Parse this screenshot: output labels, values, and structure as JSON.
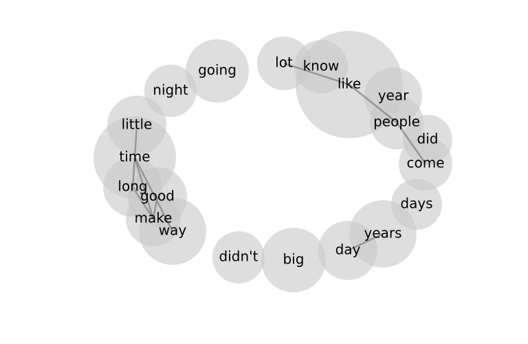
{
  "diagram": {
    "type": "word-bubble-network",
    "bubble_color": "#c8c8c8",
    "edge_color": "#8a8a8a",
    "text_color": "#000000",
    "words": [
      {
        "id": "like",
        "label": "like"
      },
      {
        "id": "know",
        "label": "know"
      },
      {
        "id": "lot",
        "label": "lot"
      },
      {
        "id": "year",
        "label": "year"
      },
      {
        "id": "people",
        "label": "people"
      },
      {
        "id": "did",
        "label": "did"
      },
      {
        "id": "come",
        "label": "come"
      },
      {
        "id": "days",
        "label": "days"
      },
      {
        "id": "years",
        "label": "years"
      },
      {
        "id": "day",
        "label": "day"
      },
      {
        "id": "big",
        "label": "big"
      },
      {
        "id": "didnt",
        "label": "didn't"
      },
      {
        "id": "way",
        "label": "way"
      },
      {
        "id": "make",
        "label": "make"
      },
      {
        "id": "good",
        "label": "good"
      },
      {
        "id": "long",
        "label": "long"
      },
      {
        "id": "time",
        "label": "time"
      },
      {
        "id": "little",
        "label": "little"
      },
      {
        "id": "night",
        "label": "night"
      },
      {
        "id": "going",
        "label": "going"
      }
    ],
    "edges": [
      [
        "lot",
        "like"
      ],
      [
        "like",
        "people"
      ],
      [
        "people",
        "come"
      ],
      [
        "day",
        "years"
      ],
      [
        "little",
        "time"
      ],
      [
        "time",
        "long"
      ],
      [
        "time",
        "make"
      ],
      [
        "time",
        "way"
      ],
      [
        "long",
        "make"
      ],
      [
        "good",
        "make"
      ]
    ]
  }
}
